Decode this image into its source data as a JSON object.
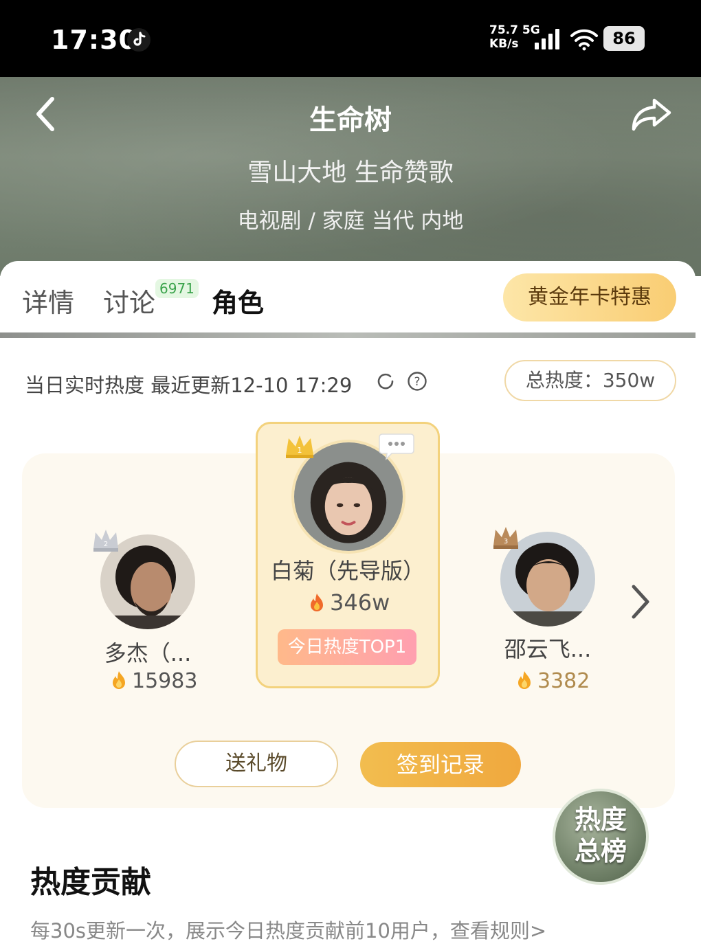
{
  "status_bar": {
    "time": "17:30",
    "net_speed_value": "75.7",
    "net_type": "5G",
    "net_unit": "KB/s",
    "battery": "86"
  },
  "header": {
    "title": "生命树",
    "slogan": "雪山大地 生命赞歌",
    "genre": "电视剧 / 家庭 当代 内地"
  },
  "tabs": [
    {
      "label": "详情"
    },
    {
      "label": "讨论",
      "badge": "6971"
    },
    {
      "label": "角色",
      "active": true
    }
  ],
  "gold_card_button": "黄金年卡特惠",
  "realtime": {
    "label": "当日实时热度 最近更新12-10 17:29",
    "total_heat": "总热度：350w"
  },
  "ranking": [
    {
      "rank": 1,
      "name": "白菊（先导版）",
      "heat": "346w",
      "badge": "今日热度TOP1"
    },
    {
      "rank": 2,
      "name": "多杰（...",
      "heat": "15983"
    },
    {
      "rank": 3,
      "name": "邵云飞...",
      "heat": "3382"
    }
  ],
  "actions": {
    "gift": "送礼物",
    "checkin": "签到记录"
  },
  "float_button": {
    "line1": "热度",
    "line2": "总榜"
  },
  "contribution": {
    "title": "热度贡献",
    "desc": "每30s更新一次，展示今日热度贡献前10用户，查看规则>"
  },
  "colors": {
    "accent": "#f2bd4f",
    "card_bg": "#fcefcf",
    "panel_bg": "#fdf9f0",
    "header_bg": "#76816f"
  }
}
